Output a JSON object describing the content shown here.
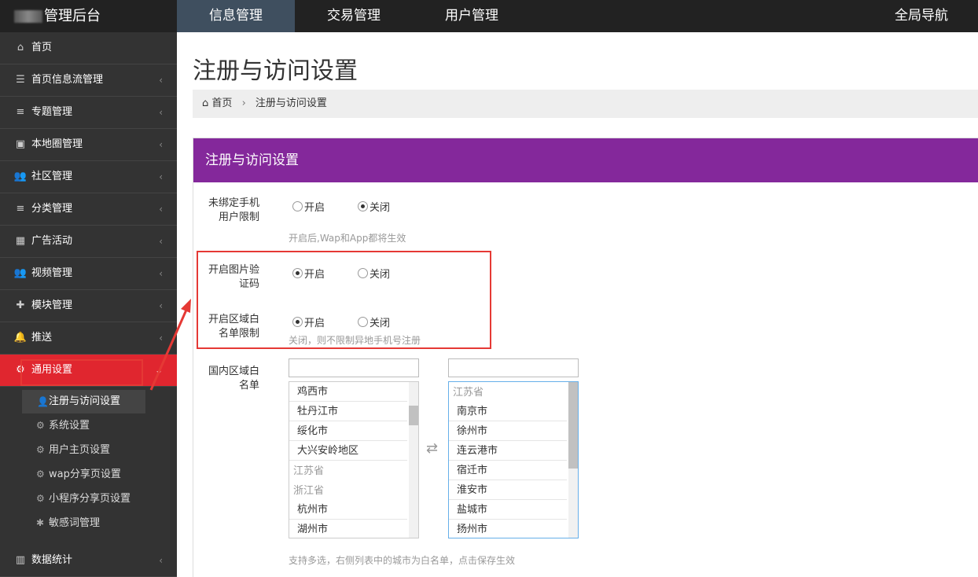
{
  "topbar": {
    "brand": "管理后台",
    "tabs": [
      {
        "label": "信息管理",
        "active": true
      },
      {
        "label": "交易管理",
        "active": false
      },
      {
        "label": "用户管理",
        "active": false
      }
    ],
    "global_nav": "全局导航"
  },
  "sidebar": {
    "items": [
      {
        "label": "首页",
        "icon": "home-icon",
        "glyph": "⌂",
        "has_chevron": false
      },
      {
        "label": "首页信息流管理",
        "icon": "rss-icon",
        "glyph": "☰",
        "has_chevron": true
      },
      {
        "label": "专题管理",
        "icon": "list-icon",
        "glyph": "≡",
        "has_chevron": true
      },
      {
        "label": "本地圈管理",
        "icon": "camera-icon",
        "glyph": "▣",
        "has_chevron": true
      },
      {
        "label": "社区管理",
        "icon": "users-icon",
        "glyph": "👥",
        "has_chevron": true
      },
      {
        "label": "分类管理",
        "icon": "list-icon",
        "glyph": "≡",
        "has_chevron": true
      },
      {
        "label": "广告活动",
        "icon": "calendar-icon",
        "glyph": "▦",
        "has_chevron": true
      },
      {
        "label": "视频管理",
        "icon": "users-icon",
        "glyph": "👥",
        "has_chevron": true
      },
      {
        "label": "模块管理",
        "icon": "puzzle-icon",
        "glyph": "✚",
        "has_chevron": true
      },
      {
        "label": "推送",
        "icon": "bell-icon",
        "glyph": "🔔",
        "has_chevron": true
      },
      {
        "label": "通用设置",
        "icon": "cogs-icon",
        "glyph": "⚙",
        "has_chevron": true,
        "active": true
      }
    ],
    "chevron_left": "‹",
    "chevron_down": "⌄",
    "sub_items": [
      {
        "label": "注册与访问设置",
        "icon": "user-icon",
        "glyph": "👤",
        "current": true
      },
      {
        "label": "系统设置",
        "icon": "cogs-icon",
        "glyph": "⚙",
        "current": false
      },
      {
        "label": "用户主页设置",
        "icon": "cogs-icon",
        "glyph": "⚙",
        "current": false
      },
      {
        "label": "wap分享页设置",
        "icon": "gear-icon",
        "glyph": "⚙",
        "current": false
      },
      {
        "label": "小程序分享页设置",
        "icon": "gear-icon",
        "glyph": "⚙",
        "current": false
      },
      {
        "label": "敏感词管理",
        "icon": "asterisk-icon",
        "glyph": "✱",
        "current": false
      }
    ],
    "bottom_item": {
      "label": "数据统计",
      "icon": "bar-chart-icon",
      "glyph": "▥"
    }
  },
  "main": {
    "page_title": "注册与访问设置",
    "breadcrumb": {
      "home": "首页",
      "separator": "›",
      "current": "注册与访问设置"
    },
    "panel_title": "注册与访问设置",
    "panel_color": "#84289b",
    "settings": [
      {
        "label_line1": "未绑定手机",
        "label_line2": "用户限制",
        "on_label": "开启",
        "off_label": "关闭",
        "selected": "off",
        "hint": "开启后,Wap和App都将生效"
      },
      {
        "label_line1": "开启图片验",
        "label_line2": "证码",
        "on_label": "开启",
        "off_label": "关闭",
        "selected": "on",
        "hint": ""
      },
      {
        "label_line1": "开启区域白",
        "label_line2": "名单限制",
        "on_label": "开启",
        "off_label": "关闭",
        "selected": "on",
        "hint": "关闭，则不限制异地手机号注册"
      }
    ],
    "whitelist": {
      "label_line1": "国内区域白",
      "label_line2": "名单",
      "left_search_value": "",
      "right_search_value": "",
      "left_list": [
        {
          "type": "item",
          "text": "鸡西市"
        },
        {
          "type": "item",
          "text": "牡丹江市"
        },
        {
          "type": "item",
          "text": "绥化市"
        },
        {
          "type": "item",
          "text": "大兴安岭地区"
        },
        {
          "type": "group",
          "text": "江苏省"
        },
        {
          "type": "group",
          "text": "浙江省"
        },
        {
          "type": "item",
          "text": "杭州市"
        },
        {
          "type": "item",
          "text": "湖州市"
        }
      ],
      "right_list": [
        {
          "type": "group",
          "text": "江苏省"
        },
        {
          "type": "item",
          "text": "南京市"
        },
        {
          "type": "item",
          "text": "徐州市"
        },
        {
          "type": "item",
          "text": "连云港市"
        },
        {
          "type": "item",
          "text": "宿迁市"
        },
        {
          "type": "item",
          "text": "淮安市"
        },
        {
          "type": "item",
          "text": "盐城市"
        },
        {
          "type": "item",
          "text": "扬州市"
        }
      ],
      "swap_glyph": "⇄",
      "hint": "支持多选，右侧列表中的城市为白名单，点击保存生效"
    }
  },
  "annotation_color": "#e53935"
}
